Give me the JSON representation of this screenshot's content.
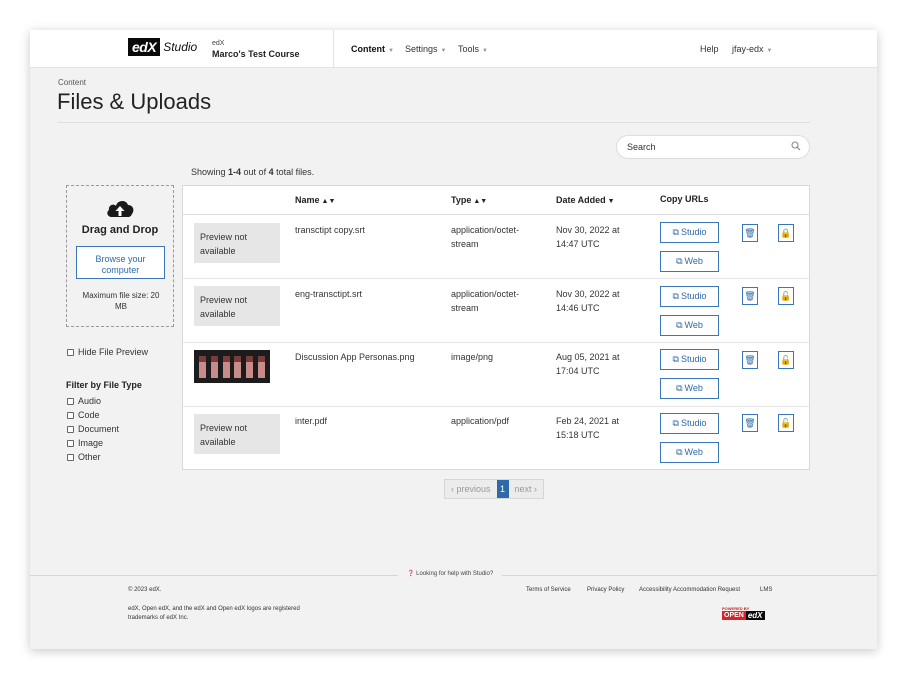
{
  "header": {
    "logo_mark": "edX",
    "logo_text": "Studio",
    "course_org": "edX",
    "course_name": "Marco's Test Course",
    "nav": [
      "Content",
      "Settings",
      "Tools"
    ],
    "help": "Help",
    "user": "jfay-edx"
  },
  "page": {
    "breadcrumb": "Content",
    "title": "Files & Uploads"
  },
  "search": {
    "placeholder": "Search"
  },
  "showing": {
    "prefix": "Showing ",
    "range": "1-4",
    "middle": " out of ",
    "total": "4",
    "suffix": " total files."
  },
  "dropzone": {
    "title": "Drag and Drop",
    "browse_line1": "Browse your",
    "browse_line2": "computer",
    "max_line1": "Maximum file size: 20",
    "max_line2": "MB"
  },
  "hide_preview": "Hide File Preview",
  "filter": {
    "title": "Filter by File Type",
    "options": [
      "Audio",
      "Code",
      "Document",
      "Image",
      "Other"
    ]
  },
  "table": {
    "headers": [
      "Name",
      "Type",
      "Date Added",
      "Copy URLs"
    ],
    "preview_line1": "Preview not",
    "preview_line2": "available",
    "studio_label": "Studio",
    "web_label": "Web",
    "rows": [
      {
        "name": "transctipt copy.srt",
        "type1": "application/octet-",
        "type2": "stream",
        "date1": "Nov 30, 2022 at",
        "date2": "14:47 UTC",
        "locked": "true"
      },
      {
        "name": "eng-transctipt.srt",
        "type1": "application/octet-",
        "type2": "stream",
        "date1": "Nov 30, 2022 at",
        "date2": "14:46 UTC",
        "locked": "false"
      },
      {
        "name": "Discussion App Personas.png",
        "type1": "image/png",
        "type2": "",
        "date1": "Aug 05, 2021 at",
        "date2": "17:04 UTC",
        "locked": "false"
      },
      {
        "name": "inter.pdf",
        "type1": "application/pdf",
        "type2": "",
        "date1": "Feb 24, 2021 at",
        "date2": "15:18 UTC",
        "locked": "false"
      }
    ]
  },
  "pagination": {
    "previous": "previous",
    "current": "1",
    "next": "next"
  },
  "footer": {
    "help": "Looking for help with Studio?",
    "copyright": "© 2023 edX.",
    "trademark_line1": "edX, Open edX, and the edX and Open edX logos are registered",
    "trademark_line2": "trademarks of edX Inc.",
    "links": [
      "Terms of Service",
      "Privacy Policy",
      "Accessibility Accommodation Request",
      "LMS"
    ],
    "powered_by": "POWERED BY",
    "open": "OPEN",
    "edx": "edX"
  },
  "colors": {
    "accent": "#2e6aa8",
    "background": "#f2f2f2"
  }
}
